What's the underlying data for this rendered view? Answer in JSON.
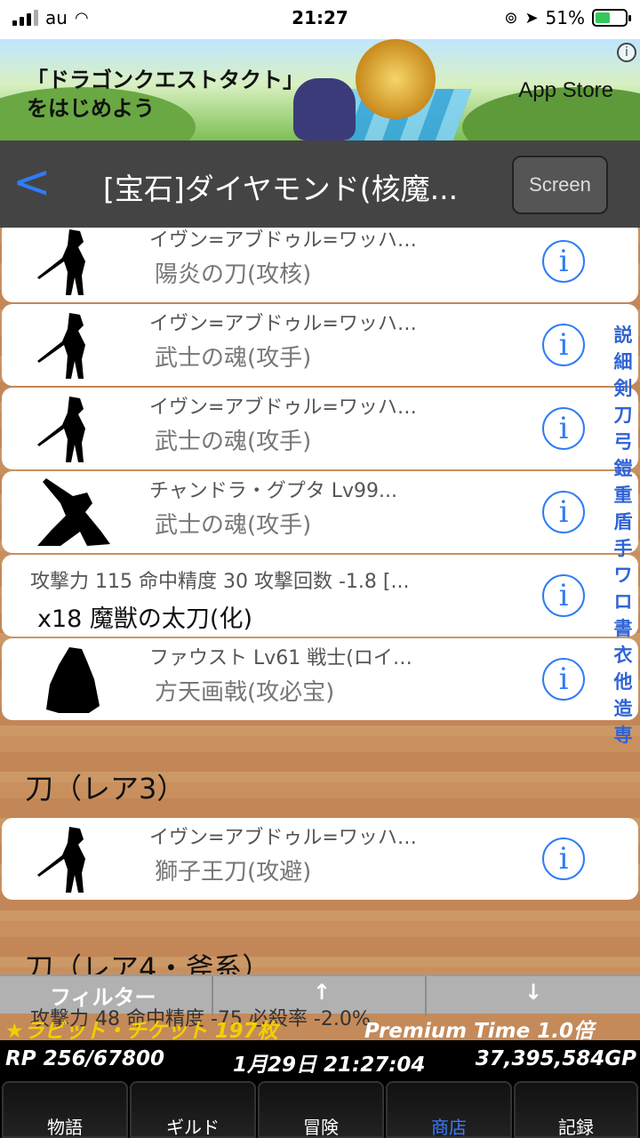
{
  "status": {
    "carrier": "au",
    "time": "21:27",
    "battery": "51%"
  },
  "ad": {
    "copy": "「ドラゴンクエストタクト」\nをはじめよう",
    "store": "App Store",
    "info": "i"
  },
  "nav": {
    "back": "<",
    "title": "[宝石]ダイヤモンド(核魔...",
    "screen": "Screen"
  },
  "rows": [
    {
      "kind": "char",
      "l1": "イヴン=アブドゥル=ワッハ…",
      "l2": "陽炎の刀(攻核)"
    },
    {
      "kind": "char",
      "l1": "イヴン=アブドゥル=ワッハ…",
      "l2": "武士の魂(攻手)"
    },
    {
      "kind": "char",
      "l1": "イヴン=アブドゥル=ワッハ…",
      "l2": "武士の魂(攻手)"
    },
    {
      "kind": "char",
      "l1": "チャンドラ・グプタ Lv99...",
      "l2": "武士の魂(攻手)"
    },
    {
      "kind": "stat",
      "l1": "攻撃力 115 命中精度 30 攻撃回数 -1.8 [...",
      "l2": "x18  魔獣の太刀(化)"
    },
    {
      "kind": "char",
      "l1": "ファウスト Lv61 戦士(ロイ…",
      "l2": "方天画戟(攻必宝)"
    },
    {
      "kind": "char",
      "l1": "イヴン=アブドゥル=ワッハ…",
      "l2": "獅子王刀(攻避)"
    }
  ],
  "sections": [
    "刀（レア3）",
    "刀（レア4・斧系）"
  ],
  "info_glyph": "i",
  "index": [
    "説",
    "細",
    "剣",
    "刀",
    "弓",
    "鎧",
    "重",
    "盾",
    "手",
    "ワ",
    "ロ",
    "書",
    "衣",
    "他",
    "造",
    "専"
  ],
  "filter": {
    "label": "フィルター",
    "up": "↑",
    "down": "↓"
  },
  "overlay_stat": "攻撃力 48 命中精度 -75 必殺率 -2.0%",
  "ticket": {
    "left": "★ラビット・チケット 197枚",
    "right": "Premium Time 1.0倍"
  },
  "rp": {
    "rp": "RP 256/67800",
    "date": "1月29日 21:27:04",
    "gp": "37,395,584GP"
  },
  "tabs": [
    "物語",
    "ギルド",
    "冒険",
    "商店",
    "記録"
  ],
  "active_tab": "商店"
}
